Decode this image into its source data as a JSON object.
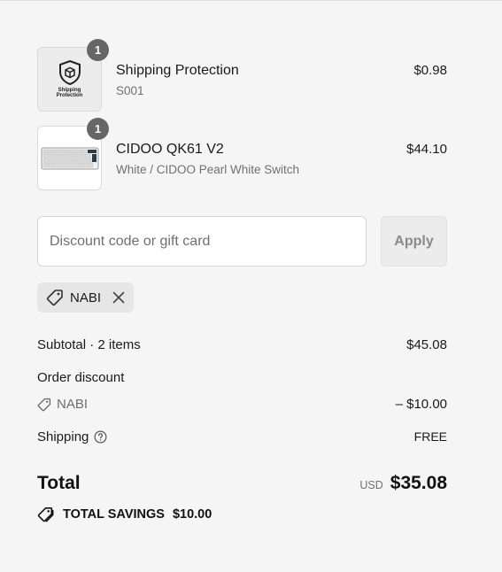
{
  "items": [
    {
      "name": "Shipping Protection",
      "sub": "S001",
      "price": "$0.98",
      "quantity": "1",
      "image_text": "Shipping Protection"
    },
    {
      "name": "CIDOO QK61 V2",
      "sub": "White / CIDOO Pearl White Switch",
      "price": "$44.10",
      "quantity": "1"
    }
  ],
  "discount": {
    "placeholder": "Discount code or gift card",
    "value": "",
    "apply_label": "Apply",
    "applied_code": "NABI"
  },
  "summary": {
    "subtotal_label": "Subtotal · 2 items",
    "subtotal_value": "$45.08",
    "order_discount_label": "Order discount",
    "discount_code": "NABI",
    "discount_value": "– $10.00",
    "shipping_label": "Shipping",
    "shipping_value": "FREE",
    "total_label": "Total",
    "currency": "USD",
    "total_value": "$35.08",
    "savings_label": "TOTAL SAVINGS",
    "savings_value": "$10.00"
  },
  "icons": {
    "tag": "tag-icon",
    "close": "close-icon",
    "help": "help-circle-icon",
    "shield": "shield-box-icon"
  }
}
